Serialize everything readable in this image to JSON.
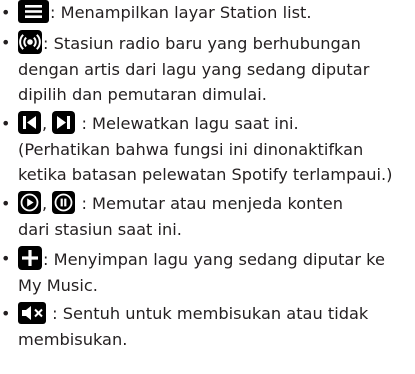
{
  "items": [
    {
      "icon": "station-list-menu-icon",
      "lines": [
        ": Menampilkan layar Station list."
      ]
    },
    {
      "icon": "radio-broadcast-icon",
      "lines": [
        ": Stasiun radio baru yang berhubungan",
        "dengan artis dari lagu yang sedang diputar",
        "dipilih dan pemutaran dimulai."
      ]
    },
    {
      "icons": [
        "skip-previous-icon",
        "skip-next-icon"
      ],
      "separator": ",",
      "lines": [
        " : Melewatkan lagu saat ini.",
        "(Perhatikan bahwa fungsi ini dinonaktifkan",
        "ketika batasan pelewatan Spotify terlampaui.)"
      ]
    },
    {
      "icons": [
        "play-icon",
        "pause-icon"
      ],
      "separator": ",",
      "lines": [
        " : Memutar atau menjeda konten",
        "dari stasiun saat ini."
      ]
    },
    {
      "icon": "add-plus-icon",
      "lines": [
        ": Menyimpan lagu yang sedang diputar ke",
        "My Music."
      ]
    },
    {
      "icon": "mute-speaker-icon",
      "lines": [
        " : Sentuh untuk membisukan atau tidak",
        "membisukan."
      ]
    }
  ],
  "bullet": "•"
}
